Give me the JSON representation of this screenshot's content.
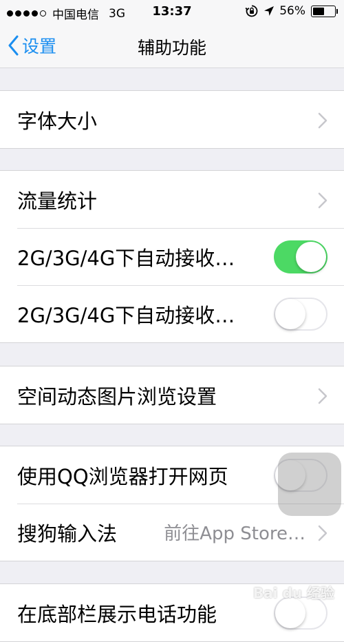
{
  "status_bar": {
    "carrier": "中国电信",
    "network": "3G",
    "time": "13:37",
    "battery_percent": "56%",
    "battery_level": 0.56,
    "icons": [
      "signal-dots",
      "rotation-lock-icon",
      "location-arrow-icon",
      "battery-icon"
    ]
  },
  "nav": {
    "back_label": "设置",
    "title": "辅助功能"
  },
  "groups": [
    {
      "rows": [
        {
          "label": "字体大小",
          "accessory": "chevron"
        }
      ]
    },
    {
      "rows": [
        {
          "label": "流量统计",
          "accessory": "chevron"
        },
        {
          "label": "2G/3G/4G下自动接收…",
          "accessory": "toggle",
          "state": "on"
        },
        {
          "label": "2G/3G/4G下自动接收…",
          "accessory": "toggle",
          "state": "off"
        }
      ]
    },
    {
      "rows": [
        {
          "label": "空间动态图片浏览设置",
          "accessory": "chevron"
        }
      ]
    },
    {
      "rows": [
        {
          "label": "使用QQ浏览器打开网页",
          "accessory": "toggle",
          "state": "off"
        },
        {
          "label": "搜狗输入法",
          "detail": "前往App Store…",
          "accessory": "chevron"
        }
      ]
    },
    {
      "rows": [
        {
          "label": "在底部栏展示电话功能",
          "accessory": "toggle",
          "state": "off"
        }
      ]
    }
  ],
  "colors": {
    "accent": "#1a8ef0",
    "toggle_on": "#4cd964",
    "background": "#efeff4"
  },
  "watermark": "Bai du 经验"
}
